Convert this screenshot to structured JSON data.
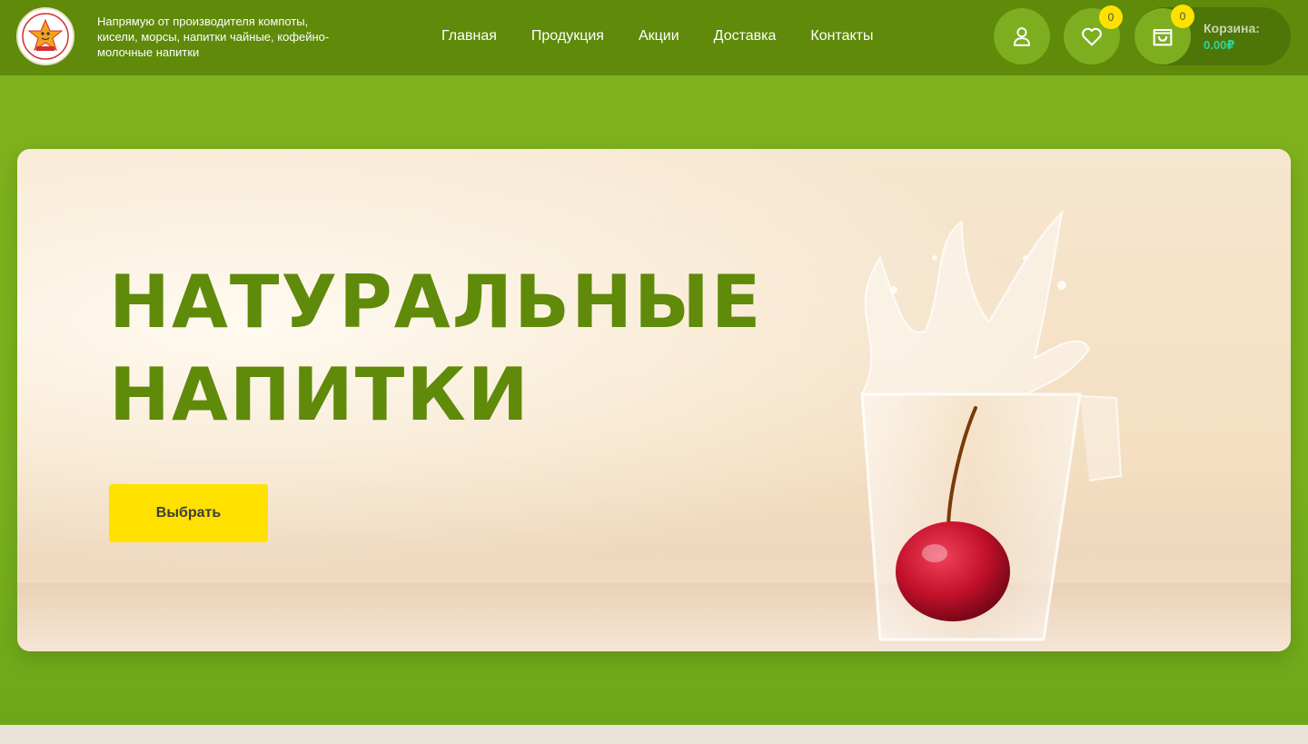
{
  "header": {
    "tagline": "Напрямую от производителя компоты, кисели, морсы, напитки чайные, кофейно-молочные напитки",
    "nav": [
      {
        "label": "Главная"
      },
      {
        "label": "Продукция"
      },
      {
        "label": "Акции"
      },
      {
        "label": "Доставка"
      },
      {
        "label": "Контакты"
      }
    ],
    "account_icon": "user-icon",
    "wishlist": {
      "icon": "heart-icon",
      "count": "0"
    },
    "cart": {
      "icon": "shopping-bag-icon",
      "count": "0",
      "label": "Корзина:",
      "total": "0.00₽"
    }
  },
  "hero": {
    "headline_line1": "НАТУРАЛЬНЫЕ",
    "headline_line2": "НАПИТКИ",
    "cta_label": "Выбрать"
  },
  "colors": {
    "header_bg": "#5f8a0a",
    "hero_bg": "#7eb21e",
    "accent_yellow": "#ffe100",
    "headline_green": "#5f8a0a",
    "cart_total": "#34d399"
  }
}
